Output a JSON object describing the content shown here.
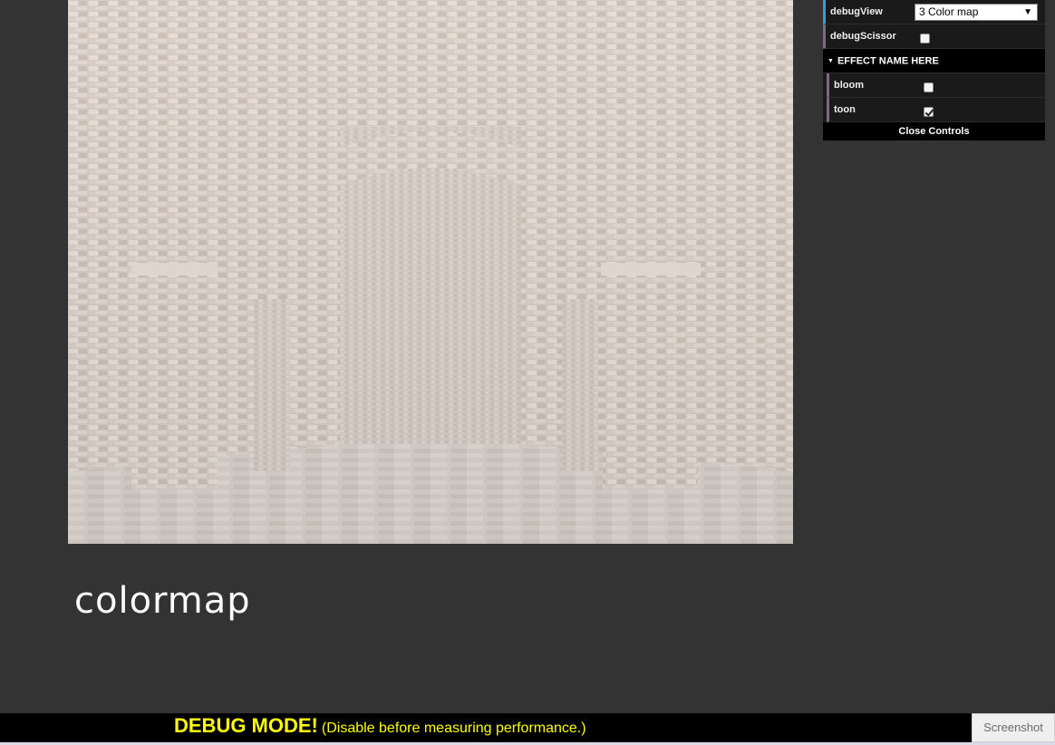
{
  "canvas": {
    "caption": "colormap"
  },
  "gui": {
    "debug_view": {
      "label": "debugView",
      "selected": "3 Color map"
    },
    "debug_scissor": {
      "label": "debugScissor",
      "checked": false
    },
    "effect_folder": {
      "title": "EFFECT NAME HERE",
      "bloom": {
        "label": "bloom",
        "checked": false
      },
      "toon": {
        "label": "toon",
        "checked": true
      }
    },
    "close_label": "Close Controls"
  },
  "debug_bar": {
    "strong": "DEBUG MODE!",
    "note": "(Disable before measuring performance.)"
  },
  "screenshot_button": "Screenshot",
  "colors": {
    "page_background": "#333333",
    "debug_text": "#ffff00",
    "gui_accent_blue": "#2fa1d6",
    "gui_accent_purple": "#806787"
  }
}
